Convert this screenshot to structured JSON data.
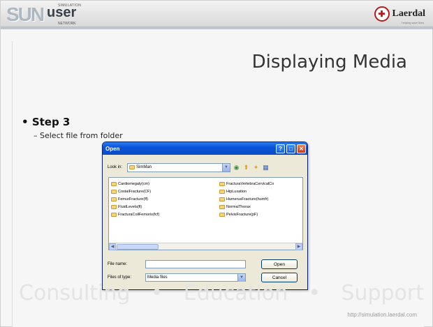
{
  "header": {
    "logo_sun": "SUN",
    "logo_user": "user",
    "logo_simulation": "SIMULATION",
    "logo_network": "NETWORK",
    "brand": "Laerdal",
    "brand_tagline": "helping save lives"
  },
  "slide": {
    "title": "Displaying Media",
    "bullet": "Step 3",
    "sub_bullet": "Select file from folder",
    "watermark": [
      "Consulting",
      "•",
      "Education",
      "•",
      "Support"
    ],
    "footer_url": "http://simulation.laerdal.com"
  },
  "dialog": {
    "title": "Open",
    "look_in_label": "Look in:",
    "look_in_value": "SimMan",
    "files_left": [
      "Cardiomegaly(cm)",
      "CostalFracture(CF)",
      "FemurFracture(ff)",
      "FluidLevels(fl)",
      "FracturaCollFemoris(fcf)"
    ],
    "files_right": [
      "FracturaVertebraCervicalCo",
      "HipLuxation",
      "HumerusFracture(humfr)",
      "NormalThorax",
      "PelvisFracture(pF)"
    ],
    "file_name_label": "File name:",
    "file_name_value": "",
    "file_type_label": "Files of type:",
    "file_type_value": "Media files",
    "open_button": "Open",
    "cancel_button": "Cancel"
  },
  "colors": {
    "titlebar": "#0a53d9",
    "dialog_bg": "#ece9d8",
    "folder": "#f4d37c",
    "laerdal_red": "#b71c1c"
  },
  "icons": {
    "back": "back-arrow-icon",
    "up": "up-folder-icon",
    "new_folder": "new-folder-icon",
    "views": "views-menu-icon"
  }
}
